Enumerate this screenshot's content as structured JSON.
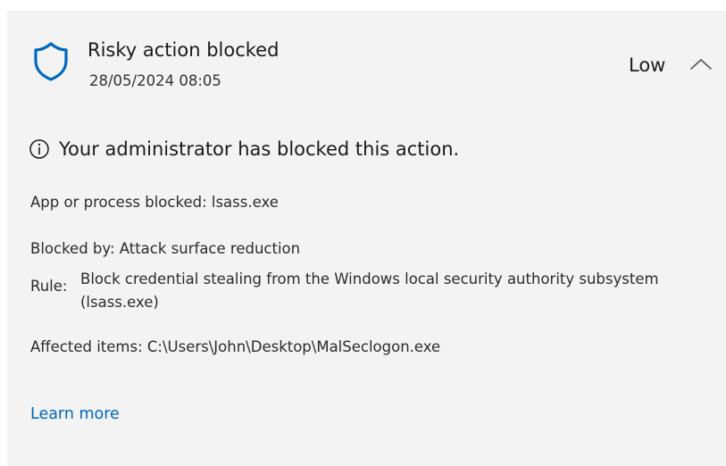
{
  "notification": {
    "title": "Risky action blocked",
    "timestamp": "28/05/2024 08:05",
    "severity": "Low",
    "info_message": "Your administrator has blocked this action.",
    "app_blocked": "App or process blocked: lsass.exe",
    "blocked_by": "Blocked by:  Attack surface reduction",
    "rule_label": "Rule:",
    "rule_text": "Block credential stealing from the Windows local security authority subsystem (lsass.exe)",
    "affected_items": "Affected items: C:\\Users\\John\\Desktop\\MalSeclogon.exe",
    "learn_more": "Learn more"
  },
  "icons": {
    "shield": "shield-icon",
    "info": "info-icon",
    "collapse": "chevron-up-icon"
  },
  "colors": {
    "card_background": "#f3f3f3",
    "shield_blue": "#0067c0",
    "link_blue": "#0067c0"
  }
}
